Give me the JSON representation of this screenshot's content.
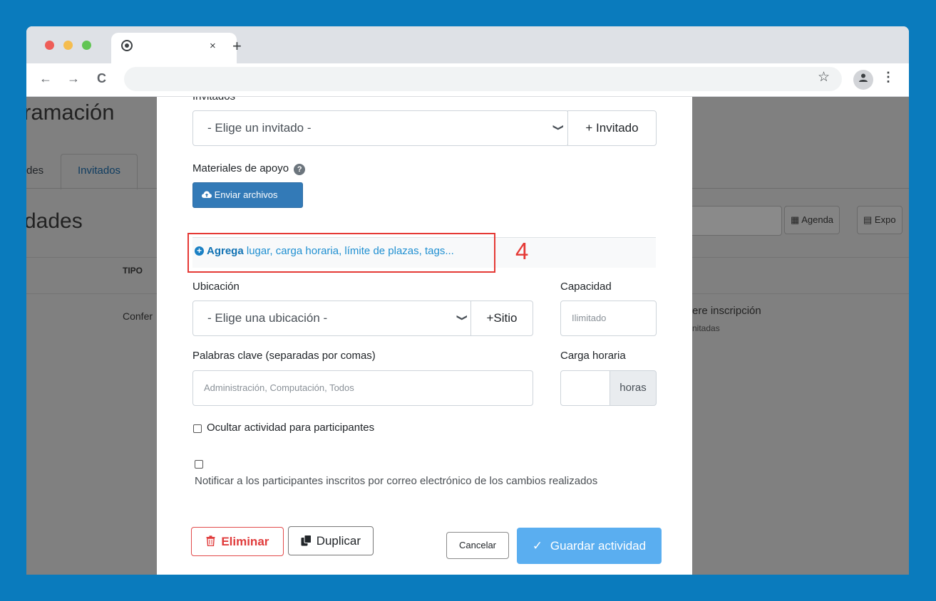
{
  "browser": {
    "tab_icon": "chrome-icon",
    "tab_close": "×",
    "new_tab": "+",
    "traffic_light_colors": [
      "#ee5d58",
      "#f5bd4f",
      "#62c554"
    ],
    "nav_back": "←",
    "nav_forward": "→",
    "nav_reload": "C",
    "star_icon": "☆",
    "profile_icon": "👤",
    "menu_icon": "⋮"
  },
  "background": {
    "title": "ramación",
    "tab_actividades": "des",
    "tab_invitados": "Invitados",
    "heading": "dades",
    "btn_agenda": "Agenda",
    "btn_export": "Expo",
    "col_tipo": "TIPO",
    "row_tipo": "Confer",
    "row_inscripcion": "ere inscripción",
    "row_limitadas": "nitadas"
  },
  "modal": {
    "invitados_label": "Invitados",
    "invitado_select": "- Elige un invitado -",
    "invitado_add": "+ Invitado",
    "materiales_label": "Materiales de apoyo",
    "help_icon": "?",
    "enviar_button": "Enviar archivos",
    "agrega_bold": "Agrega",
    "agrega_rest": " lugar, carga horaria, límite de plazas, tags...",
    "annotation_number": "4",
    "ubicacion_label": "Ubicación",
    "ubicacion_select": "- Elige una ubicación -",
    "sitio_add": "+Sitio",
    "capacidad_label": "Capacidad",
    "capacidad_placeholder": "Ilimitado",
    "palabras_label": "Palabras clave (separadas por comas)",
    "palabras_placeholder": "Administración, Computación, Todos",
    "carga_label": "Carga horaria",
    "carga_suffix": "horas",
    "ocultar_label": "Ocultar actividad para participantes",
    "notificar_label": "Notificar a los participantes inscritos por correo electrónico de los cambios realizados",
    "eliminar_button": "Eliminar",
    "duplicar_button": "Duplicar",
    "cancelar_button": "Cancelar",
    "guardar_button": "Guardar actividad",
    "annotation_color": "#e53935",
    "primary_color": "#5aaef0"
  }
}
